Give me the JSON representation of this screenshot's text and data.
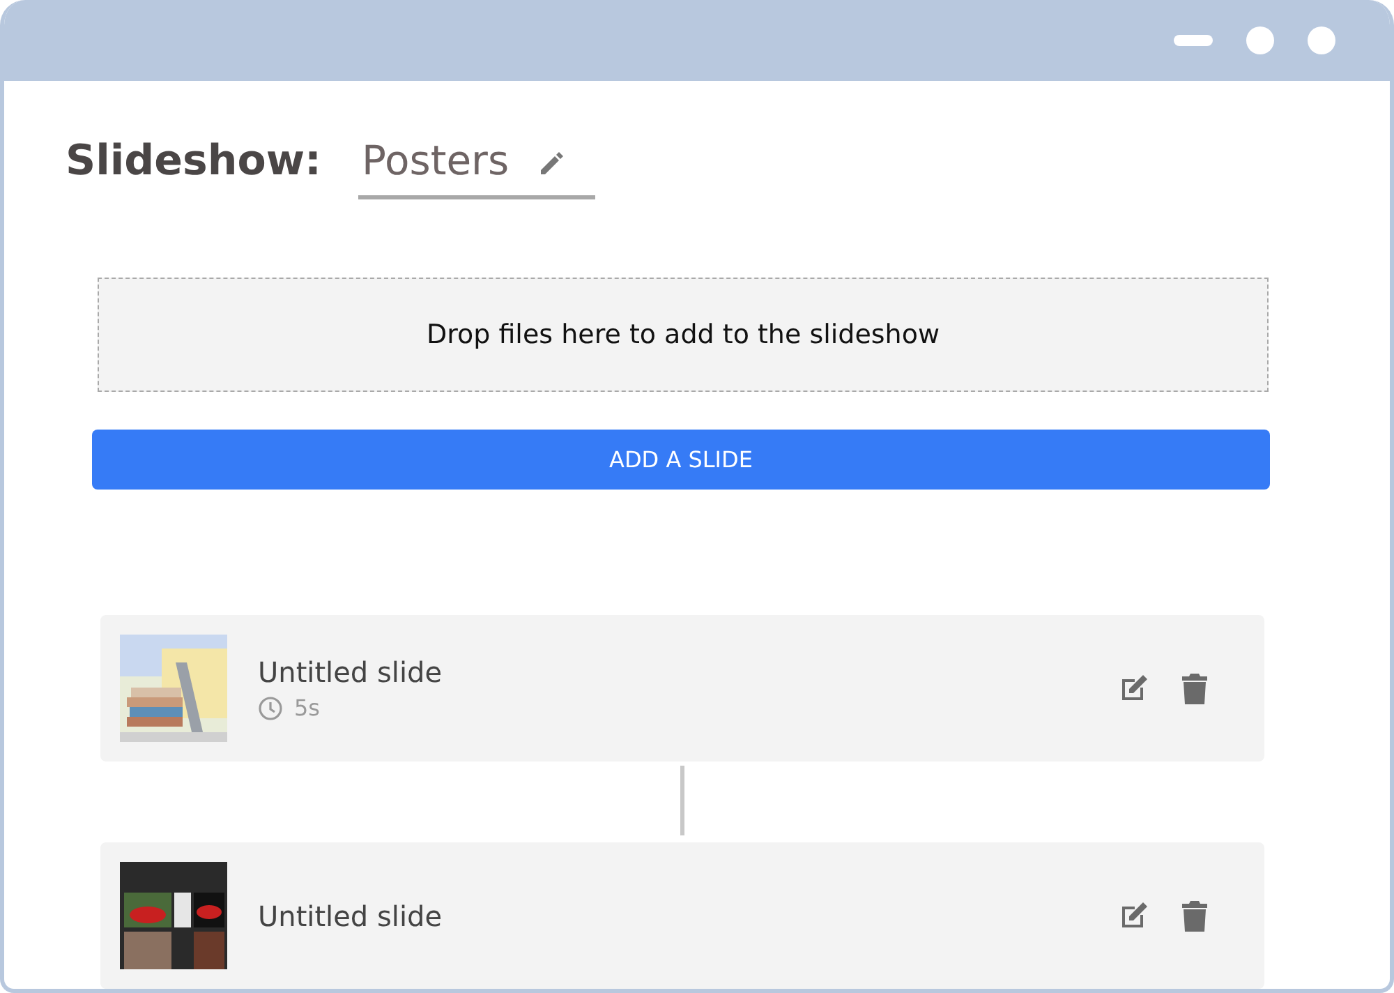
{
  "window": {
    "controls": [
      {
        "kind": "dash"
      },
      {
        "kind": "dot"
      },
      {
        "kind": "dot"
      }
    ]
  },
  "header": {
    "label": "Slideshow:",
    "name": "Posters"
  },
  "dropzone": {
    "text": "Drop files here to add to the slideshow"
  },
  "add_button": {
    "label": "ADD A SLIDE"
  },
  "slides": [
    {
      "title": "Untitled slide",
      "duration": "5s"
    },
    {
      "title": "Untitled slide"
    }
  ]
}
